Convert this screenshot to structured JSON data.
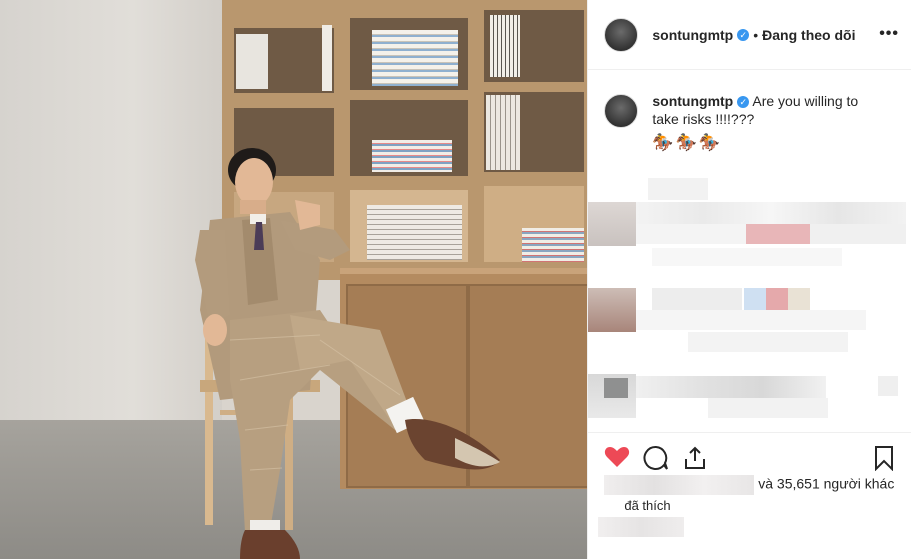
{
  "header": {
    "username": "sontungmtp",
    "dot": "•",
    "follow_status": "Đang theo dõi",
    "more": "•••"
  },
  "caption": {
    "username": "sontungmtp",
    "text": "Are you willing to take risks !!!!???",
    "emoji": "🏇🏇🏇"
  },
  "likes": {
    "text_after_mask": "và 35,651 người khác",
    "liked_label": "đã thích"
  },
  "icons": {
    "like": "heart-icon",
    "comment": "comment-icon",
    "share": "share-icon",
    "save": "bookmark-icon"
  },
  "colors": {
    "like_red": "#ed4956",
    "verified_blue": "#3897f0"
  }
}
